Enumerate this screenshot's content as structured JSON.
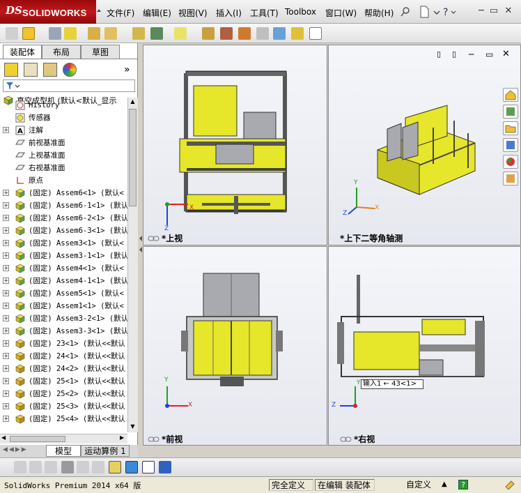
{
  "app": {
    "brand": "SOLIDWORKS",
    "brand_prefix": "DS"
  },
  "menu": [
    {
      "label": "文件(F)"
    },
    {
      "label": "编辑(E)"
    },
    {
      "label": "视图(V)"
    },
    {
      "label": "插入(I)"
    },
    {
      "label": "工具(T)"
    },
    {
      "label": "Toolbox"
    },
    {
      "label": "窗口(W)"
    },
    {
      "label": "帮助(H)"
    }
  ],
  "panel_tabs": [
    {
      "label": "装配体"
    },
    {
      "label": "布局"
    },
    {
      "label": "草图"
    }
  ],
  "tree": {
    "root": "真空成型机  (默认<默认_显示",
    "items": [
      {
        "label": "History",
        "kind": "history"
      },
      {
        "label": "传感器",
        "kind": "sensor"
      },
      {
        "label": "注解",
        "kind": "annotation",
        "expandable": true
      },
      {
        "label": "前视基准面",
        "kind": "plane"
      },
      {
        "label": "上视基准面",
        "kind": "plane"
      },
      {
        "label": "右视基准面",
        "kind": "plane"
      },
      {
        "label": "原点",
        "kind": "origin"
      },
      {
        "label": "(固定) Assem6<1> (默认<",
        "kind": "asm",
        "expandable": true
      },
      {
        "label": "(固定) Assem6-1<1> (默认",
        "kind": "asm",
        "expandable": true
      },
      {
        "label": "(固定) Assem6-2<1> (默认",
        "kind": "asm",
        "expandable": true
      },
      {
        "label": "(固定) Assem6-3<1> (默认",
        "kind": "asm",
        "expandable": true
      },
      {
        "label": "(固定) Assem3<1> (默认<",
        "kind": "asm",
        "expandable": true
      },
      {
        "label": "(固定) Assem3-1<1> (默认",
        "kind": "asm",
        "expandable": true
      },
      {
        "label": "(固定) Assem4<1> (默认<",
        "kind": "asm",
        "expandable": true
      },
      {
        "label": "(固定) Assem4-1<1> (默认",
        "kind": "asm",
        "expandable": true
      },
      {
        "label": "(固定) Assem5<1> (默认<",
        "kind": "asm",
        "expandable": true
      },
      {
        "label": "(固定) Assem1<1> (默认<",
        "kind": "asm",
        "expandable": true
      },
      {
        "label": "(固定) Assem3-2<1> (默认",
        "kind": "asm",
        "expandable": true
      },
      {
        "label": "(固定) Assem3-3<1> (默认",
        "kind": "asm",
        "expandable": true
      },
      {
        "label": "(固定) 23<1> (默认<<默认",
        "kind": "part",
        "expandable": true
      },
      {
        "label": "(固定) 24<1> (默认<<默认",
        "kind": "part",
        "expandable": true
      },
      {
        "label": "(固定) 24<2> (默认<<默认",
        "kind": "part",
        "expandable": true
      },
      {
        "label": "(固定) 25<1> (默认<<默认",
        "kind": "part",
        "expandable": true
      },
      {
        "label": "(固定) 25<2> (默认<<默认",
        "kind": "part",
        "expandable": true
      },
      {
        "label": "(固定) 25<3> (默认<<默认",
        "kind": "part",
        "expandable": true
      },
      {
        "label": "(固定) 25<4> (默认<<默认",
        "kind": "part",
        "expandable": true
      }
    ]
  },
  "bottom_tabs": [
    {
      "label": "模型"
    },
    {
      "label": "运动算例 1"
    }
  ],
  "viewports": {
    "top": {
      "label": "*上视"
    },
    "iso": {
      "label": "*上下二等角轴测"
    },
    "front": {
      "label": "*前视"
    },
    "right": {
      "label": "*右视"
    }
  },
  "axis": {
    "x": "X",
    "y": "Y",
    "z": "Z"
  },
  "tooltip": "输入1  ←  43<1>",
  "status": {
    "version": "SolidWorks Premium 2014 x64 版",
    "defined": "完全定义",
    "editing": "在编辑 装配体",
    "custom": "自定义"
  },
  "colors": {
    "machine_yellow": "#e6e62a",
    "frame_dark": "#333333",
    "panel_gray": "#a8aab0",
    "axis_red": "#e02020",
    "axis_green": "#20a020",
    "axis_blue": "#2040e0"
  }
}
